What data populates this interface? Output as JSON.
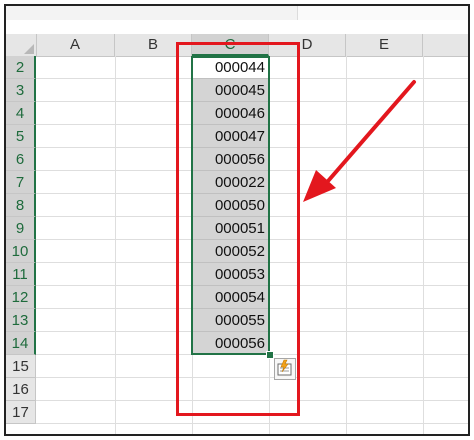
{
  "sheet": {
    "columns": [
      "A",
      "B",
      "C",
      "D",
      "E"
    ],
    "selected_column": "C",
    "rows": [
      "2",
      "3",
      "4",
      "5",
      "6",
      "7",
      "8",
      "9",
      "10",
      "11",
      "12",
      "13",
      "14",
      "15",
      "16",
      "17"
    ],
    "selected_rows": [
      "2",
      "3",
      "4",
      "5",
      "6",
      "7",
      "8",
      "9",
      "10",
      "11",
      "12",
      "13",
      "14"
    ],
    "selection": {
      "column": "C",
      "values": [
        "000044",
        "000045",
        "000046",
        "000047",
        "000056",
        "000022",
        "000050",
        "000051",
        "000052",
        "000053",
        "000054",
        "000055",
        "000056"
      ]
    }
  },
  "quick_analysis": {
    "icon": "quick-analysis-icon"
  },
  "annotation": {
    "box_color": "#e3171e",
    "arrow_color": "#e3171e"
  },
  "theme": {
    "accent": "#217346"
  }
}
